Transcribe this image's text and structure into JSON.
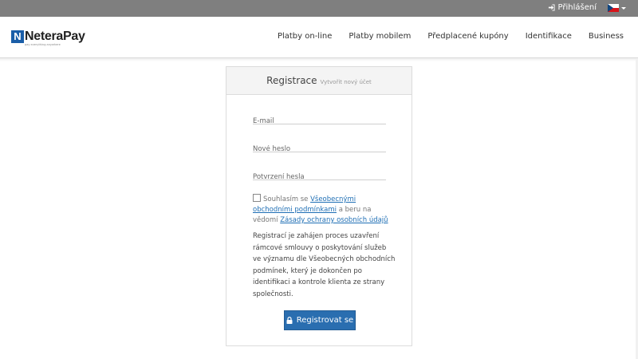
{
  "topbar": {
    "login_label": "Přihlášení",
    "language": "cs"
  },
  "brand": {
    "logo_letter": "N",
    "name": "NeteraPay",
    "tagline": "pay everything anywhere",
    "color": "#1a5ea8"
  },
  "nav": {
    "items": [
      {
        "label": "Platby on-line"
      },
      {
        "label": "Platby mobilem"
      },
      {
        "label": "Předplacené kupóny"
      },
      {
        "label": "Identifikace"
      },
      {
        "label": "Business"
      }
    ]
  },
  "form": {
    "title": "Registrace",
    "subtitle": "Vytvořit nový účet",
    "email_placeholder": "E-mail",
    "password_placeholder": "Nové heslo",
    "confirm_placeholder": "Potvrzení hesla",
    "consent": {
      "prefix": "Souhlasím se ",
      "terms_link": "Všeobecnými obchodními podmínkami",
      "middle": " a beru na vědomí ",
      "privacy_link": "Zásady ochrany osobních údajů"
    },
    "info_text": "Registrací je zahájen proces uzavření rámcové smlouvy o poskytování služeb ve významu dle Všeobecných obchodních podmínek, který je dokončen po identifikaci a kontrole klienta ze strany společnosti.",
    "submit_label": "Registrovat se",
    "accent_color": "#2a6eb0"
  }
}
